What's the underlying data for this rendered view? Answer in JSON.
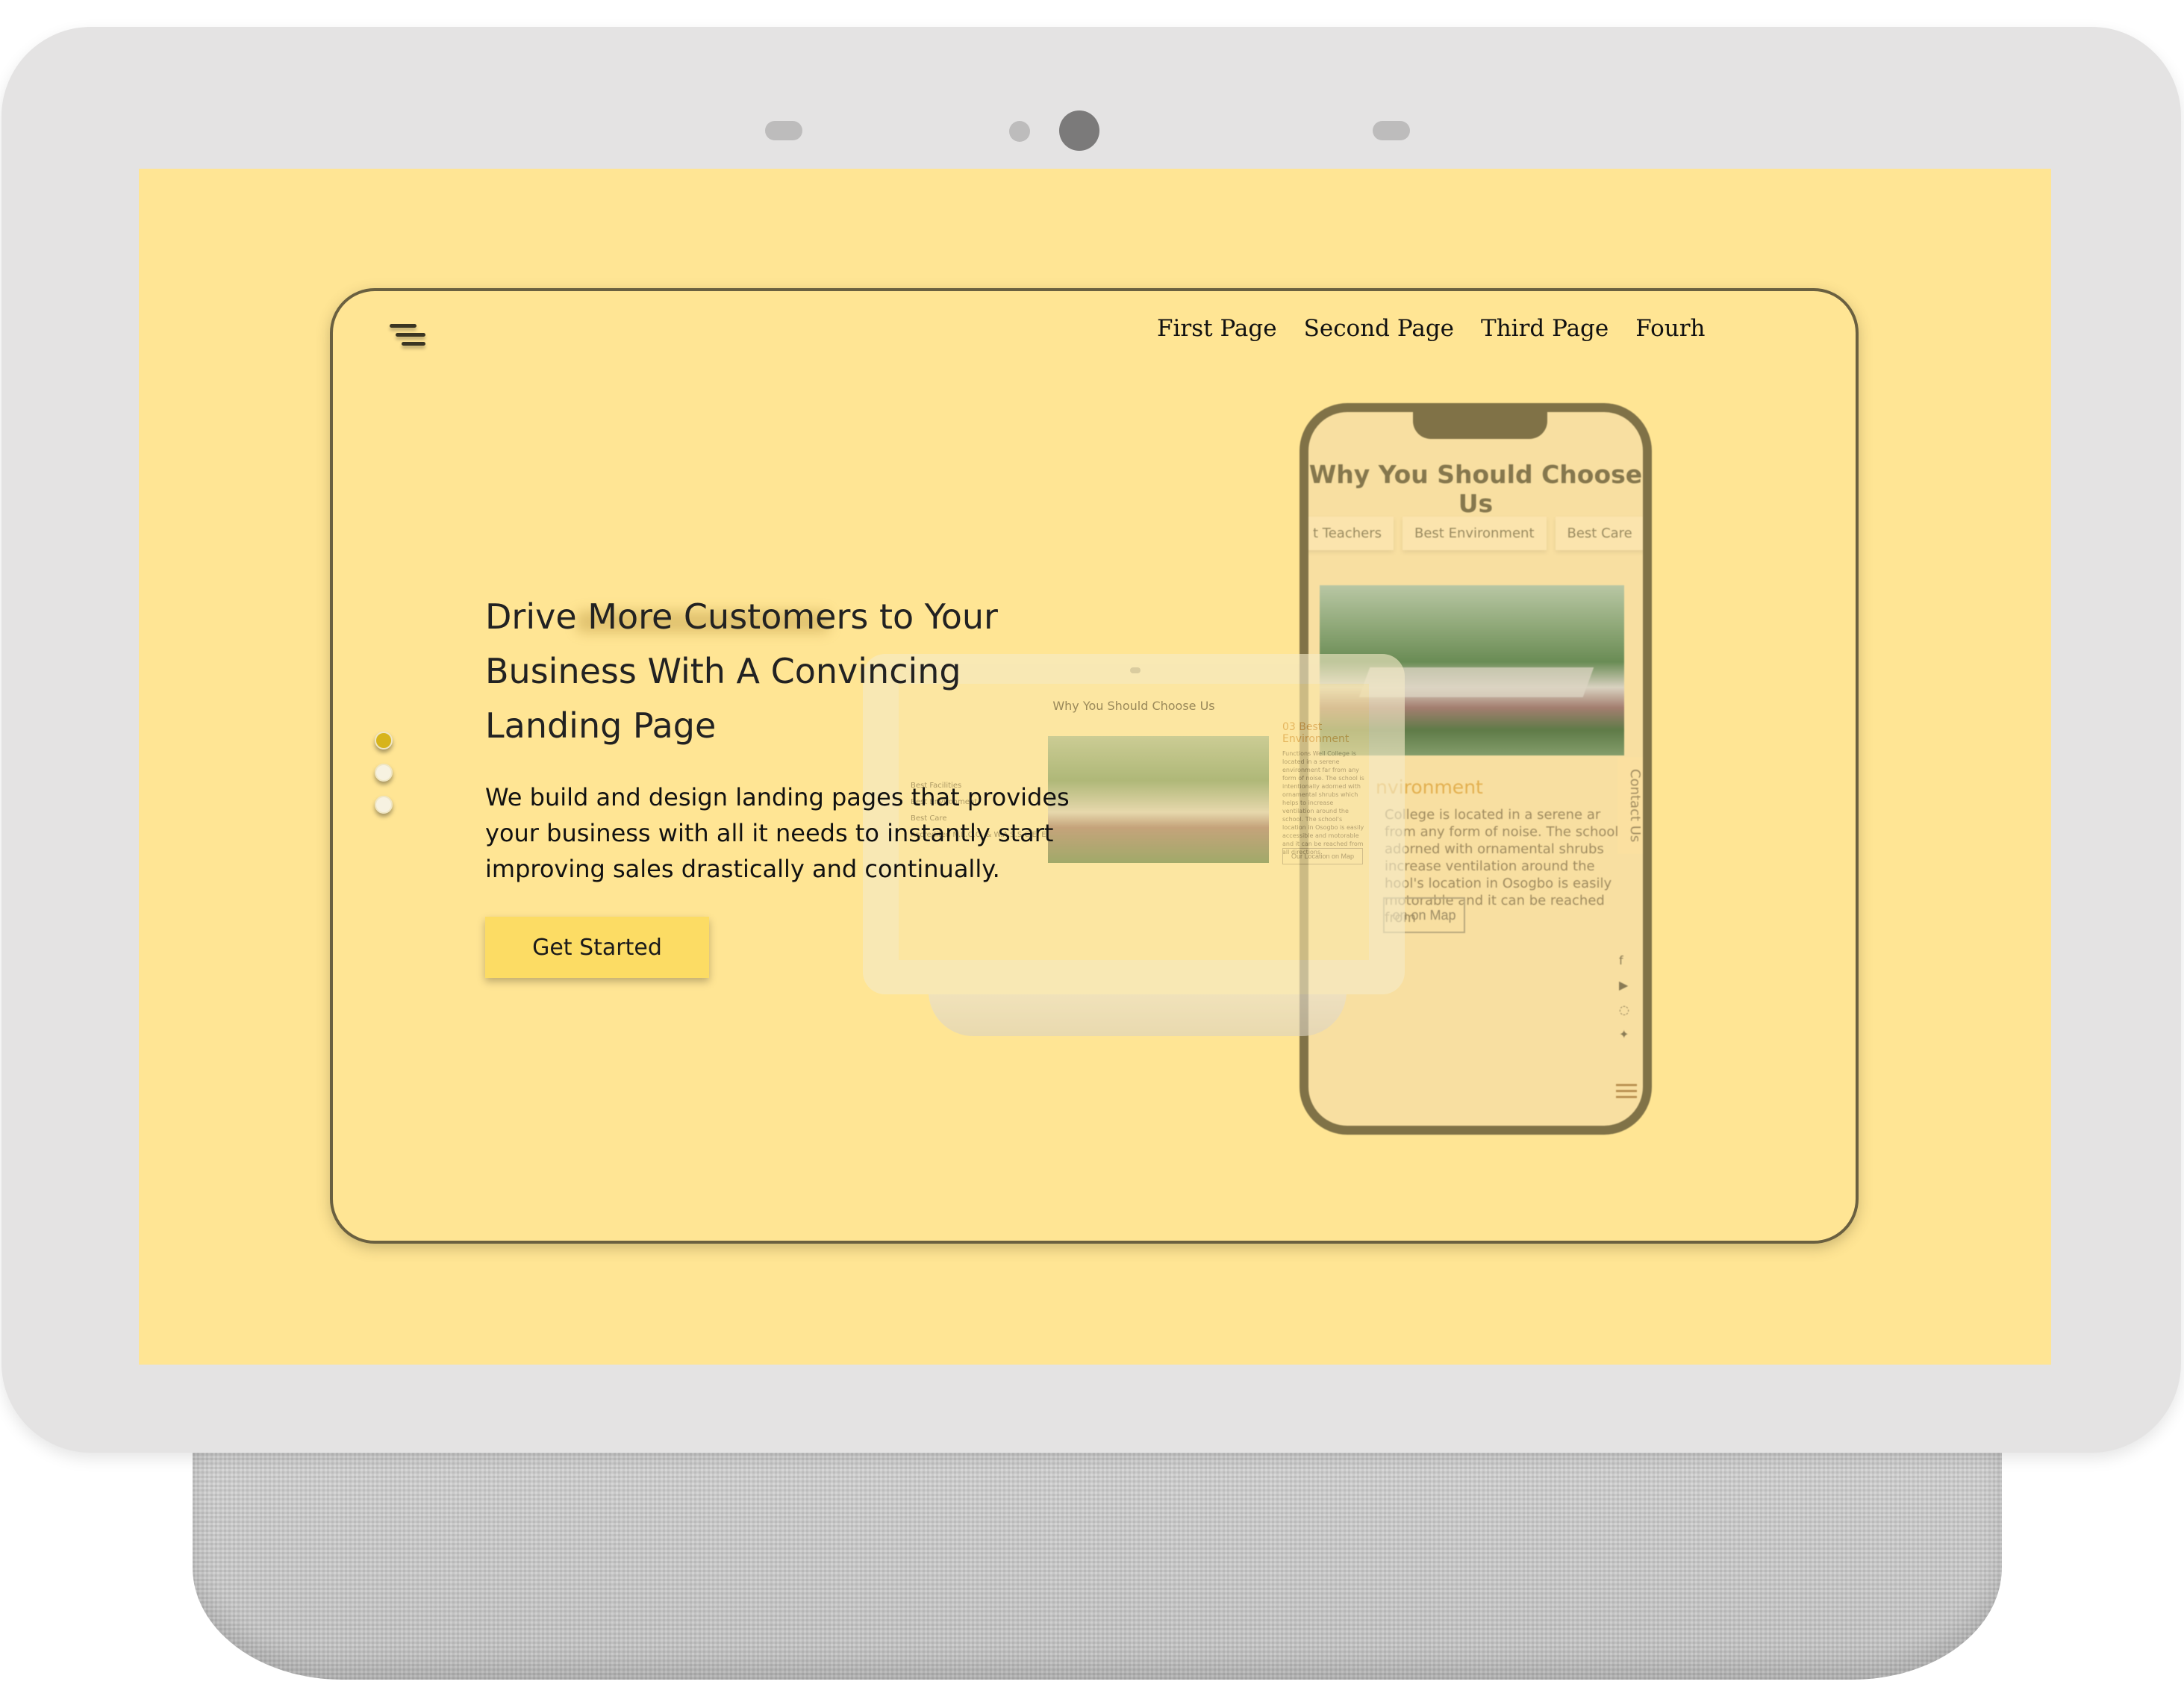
{
  "nav": {
    "links": [
      "First Page",
      "Second Page",
      "Third Page",
      "Fourh"
    ]
  },
  "hero": {
    "title": "Drive More Customers to Your Business With A Convincing Landing Page",
    "description": "We build and design landing pages that provides your business with all it needs to instantly start improving sales drastically and continually.",
    "cta_label": "Get Started"
  },
  "pager": {
    "count": 3,
    "active_index": 0,
    "active_color": "#d7b41b",
    "inactive_color": "#f7f2e1"
  },
  "phone_mockup": {
    "title": "Why You Should Choose Us",
    "tabs": [
      "t Teachers",
      "Best Environment",
      "Best Care"
    ],
    "subheading": "nvironment",
    "text": "College is located in a serene ar from any form of noise. The school adorned with ornamental shrubs increase ventilation around the hool's location in Osogbo is easily motorable and it can be reached from",
    "button": "on on Map",
    "contact_tab": "Contact Us",
    "social_icons": [
      "facebook-icon",
      "youtube-icon",
      "whatsapp-icon",
      "twitter-icon"
    ]
  },
  "tablet_mockup": {
    "title": "Why You Should Choose Us",
    "list": [
      "Best Facilities",
      "Best Environment",
      "Best Care",
      "Accredited N.E.C.O. & W.A.S.S.C.E. Exam Centre"
    ],
    "side_heading": "03 Best Environment",
    "side_text": "Functions Well College is located in a serene environment far from any form of noise. The school is intentionally adorned with ornamental shrubs which helps to increase ventilation around the school. The school's location in Osogbo is easily accessible and motorable and it can be reached from all directions.",
    "side_button": "Our Location on Map"
  },
  "colors": {
    "screen_background": "#ffe594",
    "button_background": "#fcdc64",
    "device_frame": "#e4e3e3"
  }
}
